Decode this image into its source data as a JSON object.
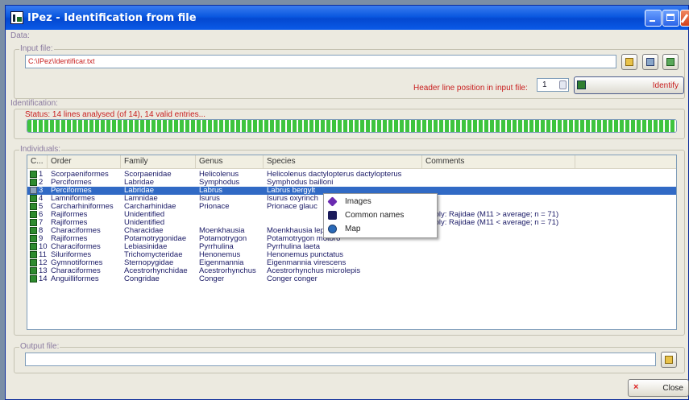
{
  "window": {
    "title": "IPez - Identification from file"
  },
  "data_section": {
    "label": "Data:",
    "input_file": {
      "label": "Input file:",
      "value": "C:\\IPez\\Identificar.txt"
    },
    "header_line": {
      "label": "Header line position in input file:",
      "value": "1"
    },
    "identify_button": "Identify"
  },
  "identification": {
    "label": "Identification:",
    "status": "Status:  14 lines analysed (of 14), 14 valid entries...",
    "progress": 1.0
  },
  "individuals": {
    "label": "Individuals:",
    "columns": [
      "C...",
      "Order",
      "Family",
      "Genus",
      "Species",
      "Comments"
    ],
    "rows": [
      {
        "n": "1",
        "order": "Scorpaeniformes",
        "family": "Scorpaenidae",
        "genus": "Helicolenus",
        "species": "Helicolenus dactylopterus dactylopterus",
        "comments": ""
      },
      {
        "n": "2",
        "order": "Perciformes",
        "family": "Labridae",
        "genus": "Symphodus",
        "species": "Symphodus bailloni",
        "comments": ""
      },
      {
        "n": "3",
        "order": "Perciformes",
        "family": "Labridae",
        "genus": "Labrus",
        "species": "Labrus bergylt",
        "comments": ""
      },
      {
        "n": "4",
        "order": "Lamniformes",
        "family": "Lamnidae",
        "genus": "Isurus",
        "species": "Isurus oxyrinch",
        "comments": ""
      },
      {
        "n": "5",
        "order": "Carcharhiniformes",
        "family": "Carcharhinidae",
        "genus": "Prionace",
        "species": "Prionace glauc",
        "comments": ""
      },
      {
        "n": "6",
        "order": "Rajiformes",
        "family": "Unidentified",
        "genus": "",
        "species": "",
        "comments": "ssibly: Rajidae (M11 > average; n = 71)"
      },
      {
        "n": "7",
        "order": "Rajiformes",
        "family": "Unidentified",
        "genus": "",
        "species": "",
        "comments": "ssibly: Rajidae (M11 < average; n = 71)"
      },
      {
        "n": "8",
        "order": "Characiformes",
        "family": "Characidae",
        "genus": "Moenkhausia",
        "species": "Moenkhausia lepidura",
        "comments": ""
      },
      {
        "n": "9",
        "order": "Rajiformes",
        "family": "Potamotrygonidae",
        "genus": "Potamotrygon",
        "species": "Potamotrygon motoro",
        "comments": ""
      },
      {
        "n": "10",
        "order": "Characiformes",
        "family": "Lebiasinidae",
        "genus": "Pyrrhulina",
        "species": "Pyrrhulina laeta",
        "comments": ""
      },
      {
        "n": "11",
        "order": "Siluriformes",
        "family": "Trichomycteridae",
        "genus": "Henonemus",
        "species": "Henonemus punctatus",
        "comments": ""
      },
      {
        "n": "12",
        "order": "Gymnotiformes",
        "family": "Sternopygidae",
        "genus": "Eigenmannia",
        "species": "Eigenmannia virescens",
        "comments": ""
      },
      {
        "n": "13",
        "order": "Characiformes",
        "family": "Acestrorhynchidae",
        "genus": "Acestrorhynchus",
        "species": "Acestrorhynchus microlepis",
        "comments": ""
      },
      {
        "n": "14",
        "order": "Anguilliformes",
        "family": "Congridae",
        "genus": "Conger",
        "species": "Conger conger",
        "comments": ""
      }
    ],
    "selected_row": 3
  },
  "context_menu": {
    "items": [
      {
        "label": "Images",
        "icon": "images-icon"
      },
      {
        "label": "Common names",
        "icon": "common-names-icon"
      },
      {
        "label": "Map",
        "icon": "map-icon"
      }
    ]
  },
  "output_file": {
    "label": "Output file:",
    "value": ""
  },
  "close_button": "Close"
}
